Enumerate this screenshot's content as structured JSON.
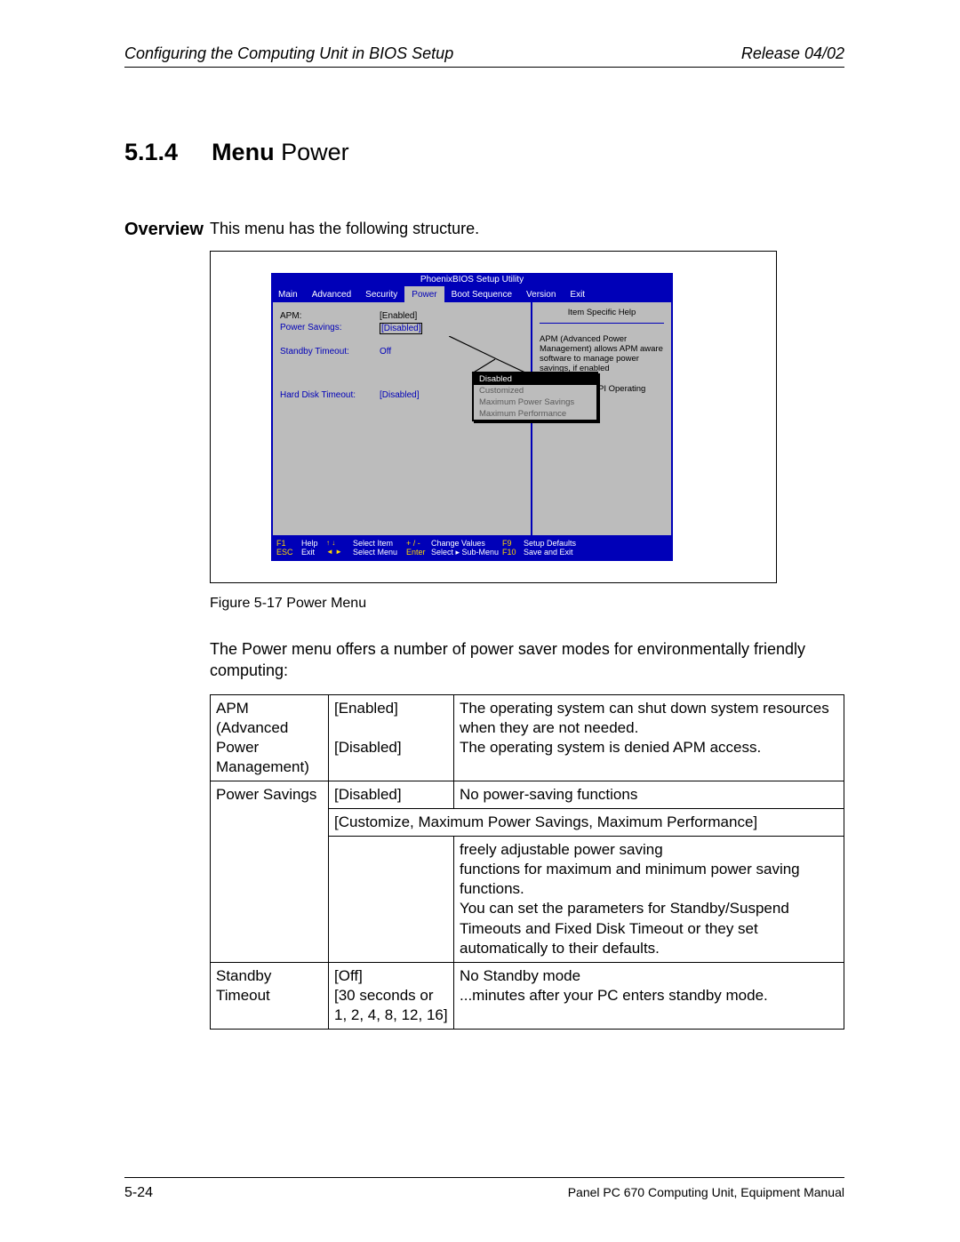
{
  "header": {
    "left": "Configuring the Computing Unit in BIOS Setup",
    "right": "Release 04/02"
  },
  "section": {
    "number": "5.1.4",
    "title_bold": "Menu",
    "title_rest": " Power"
  },
  "overview": {
    "label": "Overview",
    "intro": "This menu has the following structure."
  },
  "bios": {
    "title": "PhoenixBIOS Setup Utility",
    "menu": [
      "Main",
      "Advanced",
      "Security",
      "Power",
      "Boot Sequence",
      "Version",
      "Exit"
    ],
    "rows": [
      {
        "k": "APM:",
        "v": "[Enabled]",
        "cls": "black"
      },
      {
        "k": "Power Savings:",
        "v": "[Disabled]",
        "cls": "",
        "boxed": true
      },
      {
        "k": "",
        "v": "",
        "cls": "gap"
      },
      {
        "k": "Standby Timeout:",
        "v": "Off",
        "cls": ""
      },
      {
        "k": "",
        "v": "",
        "cls": "gap"
      },
      {
        "k": "",
        "v": "",
        "cls": "gap"
      },
      {
        "k": "Hard Disk Timeout:",
        "v": "[Disabled]",
        "cls": ""
      }
    ],
    "help": {
      "head": "Item Specific Help",
      "p1": "APM (Advanced Power Management) allows APM aware software to manage power savings, if enabled",
      "p2": "Not valid for ACPI Operating Systems"
    },
    "dropdown": [
      "Disabled",
      "Customized",
      "Maximum Power Savings",
      "Maximum Performance"
    ],
    "keys": {
      "f1": "F1",
      "help": "Help",
      "ud": "↑ ↓",
      "selitem": "Select Item",
      "pm": "+ / -",
      "chg": "Change Values",
      "f9": "F9",
      "def": "Setup Defaults",
      "esc": "ESC",
      "exit": "Exit",
      "lr": "◄ ►",
      "selmenu": "Select Menu",
      "enter": "Enter",
      "sub": "Select  ▸  Sub-Menu",
      "f10": "F10",
      "save": "Save and Exit"
    }
  },
  "figcap": "Figure 5-17    Power  Menu",
  "intro2": "The Power menu offers a number of power saver modes for environmentally friendly computing:",
  "table": {
    "r1": {
      "c1a": "APM",
      "c1b": "(Advanced Power Management)",
      "c2": [
        "[Enabled]",
        "[Disabled]"
      ],
      "c3": [
        "The operating system can shut down system resources when they are not needed.",
        "The operating system is denied APM access."
      ]
    },
    "r2": {
      "c1": "Power Savings",
      "c2a": "[Disabled]",
      "c3a": "No power-saving functions",
      "span": "[Customize, Maximum Power Savings, Maximum Performance]",
      "c3b": "freely adjustable power saving\nfunctions for maximum and minimum power saving functions.\nYou can set the parameters for Standby/Suspend Timeouts and Fixed Disk Timeout or they set automatically to their defaults."
    },
    "r3": {
      "c1": "Standby Timeout",
      "c2": [
        "[Off]",
        "[30 seconds or 1, 2, 4, 8, 12, 16]"
      ],
      "c3": [
        "No Standby mode",
        "...minutes after your PC enters standby mode."
      ]
    }
  },
  "footer": {
    "left": "5-24",
    "right": "Panel PC 670 Computing Unit, Equipment Manual"
  }
}
